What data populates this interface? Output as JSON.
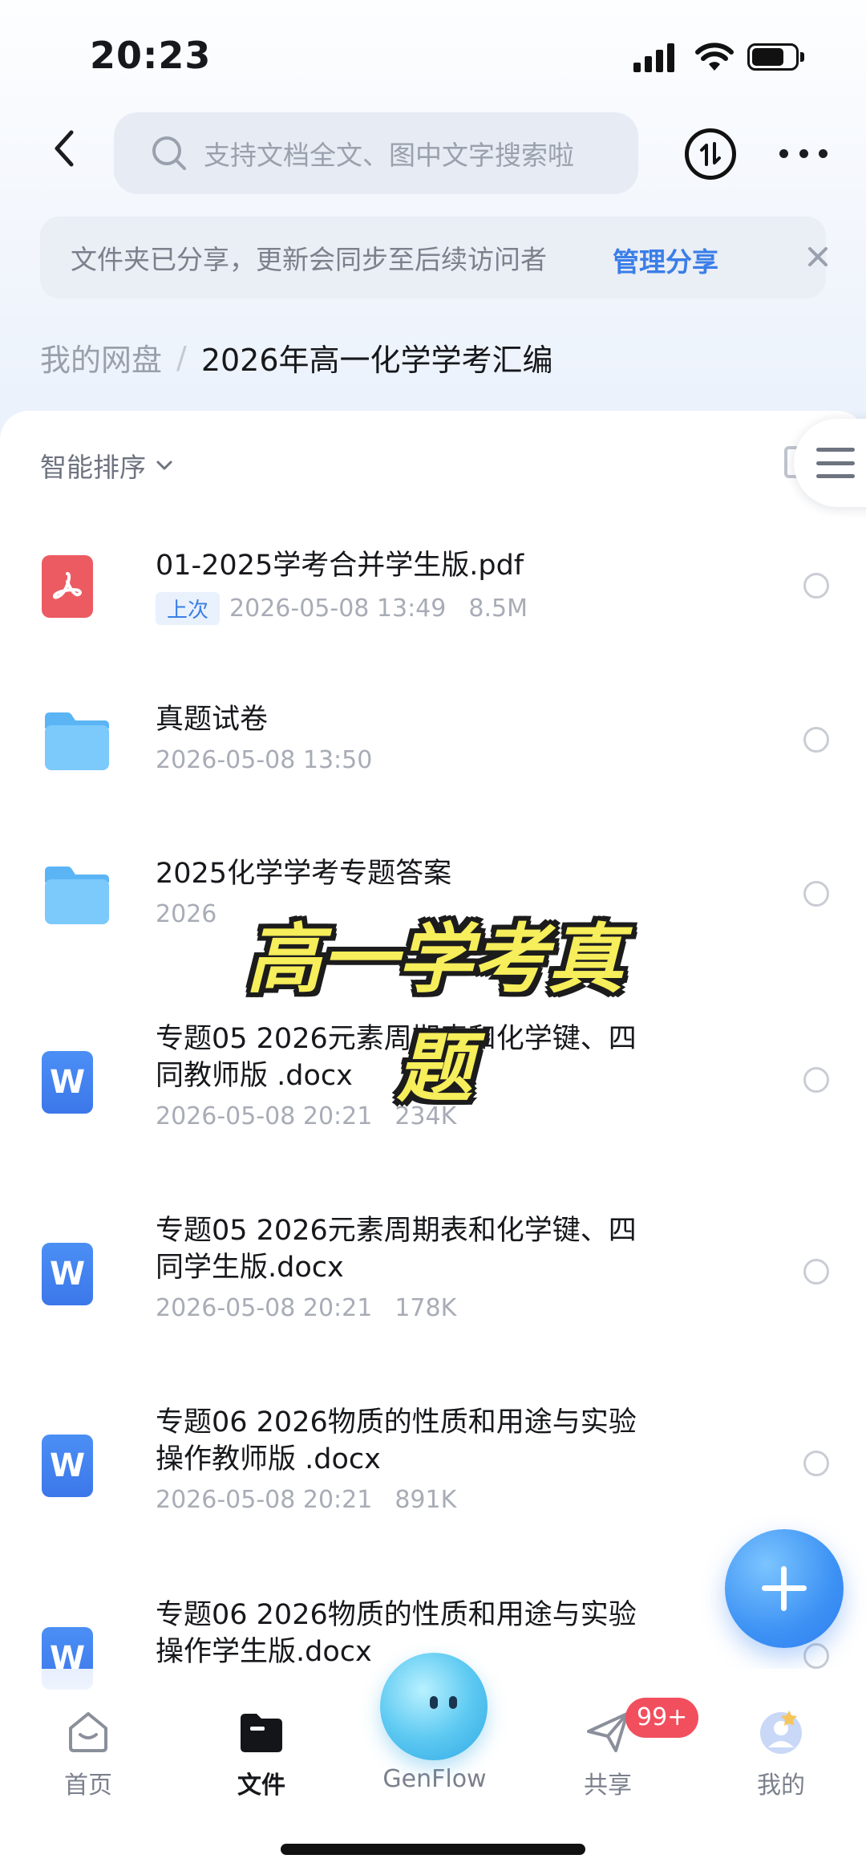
{
  "status_bar": {
    "time": "20:23",
    "battery_level": 0.75
  },
  "search": {
    "placeholder": "支持文档全文、图中文字搜索啦"
  },
  "share_notice": {
    "text": "文件夹已分享，更新会同步至后续访问者",
    "manage_label": "管理分享"
  },
  "breadcrumb": {
    "root": "我的网盘",
    "separator": "/",
    "current": "2026年高一化学学考汇编"
  },
  "sort": {
    "label": "智能排序"
  },
  "files": [
    {
      "icon": "pdf-icon",
      "name": "01-2025学考合并学生版.pdf",
      "tag": "上次",
      "date": "2026-05-08 13:49",
      "size": "8.5M"
    },
    {
      "icon": "folder-icon",
      "name": "真题试卷",
      "date": "2026-05-08 13:50"
    },
    {
      "icon": "folder-icon",
      "name": "2025化学学考专题答案",
      "date": "2026"
    },
    {
      "icon": "word-icon",
      "name_line1": "专题05  2026元素周期表和化学键、四",
      "name_line2": "同教师版 .docx",
      "date": "2026-05-08 20:21",
      "size": "234K"
    },
    {
      "icon": "word-icon",
      "name_line1": "专题05  2026元素周期表和化学键、四",
      "name_line2": "同学生版.docx",
      "date": "2026-05-08 20:21",
      "size": "178K"
    },
    {
      "icon": "word-icon",
      "name_line1": "专题06 2026物质的性质和用途与实验",
      "name_line2": "操作教师版 .docx",
      "date": "2026-05-08 20:21",
      "size": "891K"
    },
    {
      "icon": "word-icon",
      "name_line1": "专题06 2026物质的性质和用途与实验",
      "name_line2": "操作学生版.docx"
    }
  ],
  "overlay_caption": "高一学考真题",
  "bottom_nav": {
    "items": [
      {
        "label": "首页",
        "icon": "home-icon"
      },
      {
        "label": "文件",
        "icon": "folder-icon",
        "active": true
      },
      {
        "label": "GenFlow",
        "icon": "genflow-orb-icon"
      },
      {
        "label": "共享",
        "icon": "paper-plane-icon",
        "badge": "99+"
      },
      {
        "label": "我的",
        "icon": "avatar-icon"
      }
    ]
  },
  "colors": {
    "accent": "#3a7ee8",
    "pdf": "#ec5b62",
    "badge": "#f14f5e",
    "caption": "#f6ee5a"
  }
}
